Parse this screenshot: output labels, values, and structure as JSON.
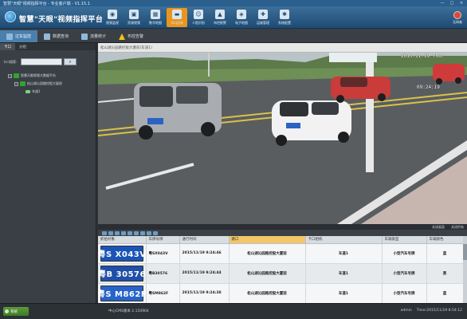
{
  "window": {
    "title": "智慧\"天眼\"视频指挥平台 - 专业客户端 - V1.15.1",
    "controls": [
      "—",
      "□",
      "×"
    ]
  },
  "header": {
    "app_title": "智慧\"天眼\"视频指挥平台",
    "modules": [
      {
        "label": "视频监视",
        "icon": "camera-icon"
      },
      {
        "label": "资源视频",
        "icon": "video-resource-icon"
      },
      {
        "label": "数字地图",
        "icon": "map-icon"
      },
      {
        "label": "卡口过车",
        "icon": "car-icon",
        "active": true
      },
      {
        "label": "人脸识别",
        "icon": "face-icon"
      },
      {
        "label": "布控报警",
        "icon": "alarm-icon"
      },
      {
        "label": "电子地图",
        "icon": "emap-icon"
      },
      {
        "label": "运维管理",
        "icon": "maintenance-icon"
      },
      {
        "label": "系统配置",
        "icon": "gear-icon"
      }
    ],
    "user_name": "无辩者"
  },
  "tabs": [
    {
      "label": "过车监控",
      "icon": "monitor-icon",
      "active": true
    },
    {
      "label": "数据查询",
      "icon": "search-icon"
    },
    {
      "label": "流量统计",
      "icon": "chart-icon"
    },
    {
      "label": "布控告警",
      "icon": "warning-icon"
    }
  ],
  "left_panel": {
    "tabs": [
      "卡口",
      "分组"
    ],
    "search_label": "卡口搜索:",
    "search_value": "",
    "tree": [
      {
        "label": "智慧天眼视频大数据平台",
        "level": 0
      },
      {
        "label": "松山湖沁园路控股大厦前",
        "level": 1
      },
      {
        "label": "车道1",
        "level": 2
      }
    ]
  },
  "video": {
    "title": "松山湖沁园路控股大厦前(车道1)",
    "osd_top": "2015-11-19 Thur",
    "osd_time": "09:24:19",
    "footer": [
      "关闭画面",
      "关闭所有"
    ]
  },
  "grid": {
    "columns": [
      "抓拍对象",
      "车牌号牌",
      "通行时间",
      "路口",
      "卡口相机",
      "车辆类型",
      "车辆颜色"
    ],
    "highlight_column": 3,
    "rows": [
      {
        "plate_img": "粤S X043V",
        "plate_color": "blue",
        "plate": "粤SX043V",
        "time": "2015/11/19 9:24:46",
        "road": "松山湖沁园路控股大厦前",
        "camera": "车道1",
        "type": "小型汽车号牌",
        "color": "蓝"
      },
      {
        "plate_img": "粤B 30576",
        "plate_color": "blue",
        "plate": "粤B30576",
        "time": "2015/11/19 9:24:44",
        "road": "松山湖沁园路控股大厦前",
        "camera": "车道1",
        "type": "小型汽车号牌",
        "color": "黑"
      },
      {
        "plate_img": "粤S M862F",
        "plate_color": "blue",
        "plate": "粤SM862F",
        "time": "2015/11/19 9:24:38",
        "road": "松山湖沁园路控股大厦前",
        "camera": "车道1",
        "type": "小型汽车号牌",
        "color": "蓝"
      }
    ]
  },
  "status": {
    "system_button": "系统",
    "version": "中心CMS版本 2.150904",
    "user": "admin",
    "time": "Time:2015/11/19 8:54:12"
  }
}
